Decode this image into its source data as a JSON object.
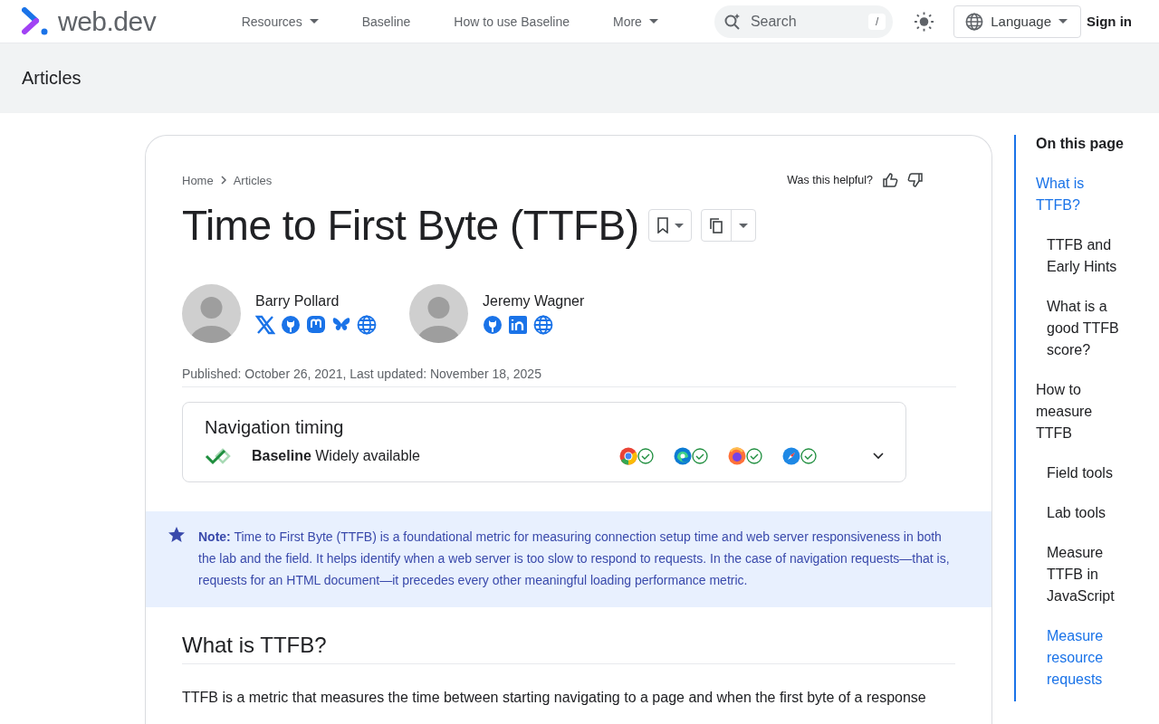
{
  "header": {
    "logo": "web.dev",
    "nav": [
      {
        "label": "Resources",
        "dropdown": true
      },
      {
        "label": "Baseline",
        "dropdown": false
      },
      {
        "label": "How to use Baseline",
        "dropdown": false
      },
      {
        "label": "More",
        "dropdown": true
      }
    ],
    "search": {
      "placeholder": "Search",
      "shortcut": "/"
    },
    "language": "Language",
    "sign_in": "Sign in"
  },
  "banner": {
    "title": "Articles"
  },
  "breadcrumbs": [
    "Home",
    "Articles"
  ],
  "helpful": "Was this helpful?",
  "title": "Time to First Byte (TTFB)",
  "authors": [
    {
      "name": "Barry Pollard",
      "links": [
        {
          "kind": "x"
        },
        {
          "kind": "github"
        },
        {
          "kind": "mastodon"
        },
        {
          "kind": "bluesky"
        },
        {
          "kind": "web"
        }
      ]
    },
    {
      "name": "Jeremy Wagner",
      "links": [
        {
          "kind": "github"
        },
        {
          "kind": "linkedin"
        },
        {
          "kind": "web"
        }
      ]
    }
  ],
  "dates": "Published: October 26, 2021, Last updated: November 18, 2025",
  "baseline": {
    "feature": "Navigation timing",
    "status": "**Baseline** Widely available",
    "expanded": false,
    "browsers": [
      {
        "kind": "chrome",
        "supported": true
      },
      {
        "kind": "edge",
        "supported": true
      },
      {
        "kind": "firefox",
        "supported": true
      },
      {
        "kind": "safari",
        "supported": true
      }
    ]
  },
  "note": "**Note:** Time to First Byte (TTFB) is a foundational metric for measuring connection setup time and web server responsiveness in both the lab and the field. It helps identify when a web server is too slow to respond to requests. In the case of navigation requests—that is, requests for an HTML document—it precedes every other meaningful loading performance metric.",
  "section": {
    "heading": "What is TTFB?",
    "paragraph": "TTFB is a metric that measures the time between starting navigating to a page and when the first byte of a response"
  },
  "toc": {
    "title": "On this page",
    "items": [
      {
        "label": "What is TTFB?",
        "selected": true,
        "children": [
          {
            "label": "TTFB and Early Hints",
            "selected": false
          },
          {
            "label": "What is a good TTFB score?",
            "selected": false
          }
        ]
      },
      {
        "label": "How to measure TTFB",
        "selected": false,
        "children": [
          {
            "label": "Field tools",
            "selected": false
          },
          {
            "label": "Lab tools",
            "selected": false
          },
          {
            "label": "Measure TTFB in JavaScript",
            "selected": false
          },
          {
            "label": "Measure resource requests",
            "selected": true
          }
        ]
      }
    ]
  }
}
